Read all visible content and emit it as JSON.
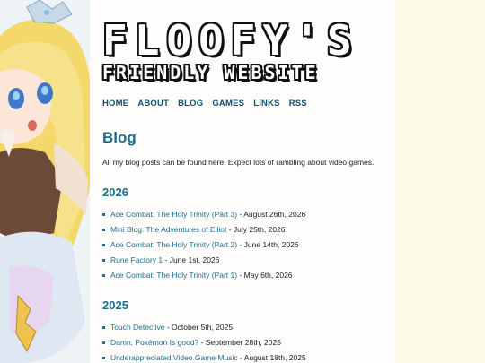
{
  "logo": {
    "line1": "FLOOFY'S",
    "line2": "FRIENDLY WEBSITE"
  },
  "nav": [
    "HOME",
    "ABOUT",
    "BLOG",
    "GAMES",
    "LINKS",
    "RSS"
  ],
  "page": {
    "title": "Blog",
    "intro": "All my blog posts can be found here! Expect lots of rambling about video games."
  },
  "years": [
    {
      "label": "2026",
      "posts": [
        {
          "title": "Ace Combat: The Holy Trinity (Part 3)",
          "date": "August 26th, 2026"
        },
        {
          "title": "Mini Blog: The Adventures of Elliot",
          "date": "July 25th, 2026"
        },
        {
          "title": "Ace Combat: The Holy Trinity (Part 2)",
          "date": "June 14th, 2026"
        },
        {
          "title": "Rune Factory 1",
          "date": "June 1st, 2026"
        },
        {
          "title": "Ace Combat: The Holy Trinity (Part 1)",
          "date": "May 6th, 2026"
        }
      ]
    },
    {
      "label": "2025",
      "posts": [
        {
          "title": "Touch Detective",
          "date": "October 5th, 2025"
        },
        {
          "title": "Damn, Pokémon Is good?",
          "date": "September 28th, 2025"
        },
        {
          "title": "Underappreciated Video Game Music",
          "date": "August 18th, 2025"
        }
      ]
    }
  ],
  "colors": {
    "accent": "#1b6e8e",
    "nav": "#14506a",
    "page_bg": "#fdfbe8",
    "panel_bg": "#fefdfb"
  }
}
